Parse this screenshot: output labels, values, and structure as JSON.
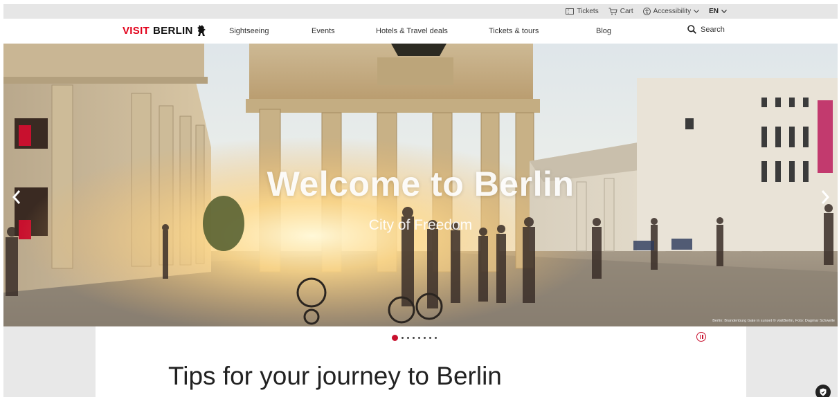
{
  "utility": {
    "tickets": "Tickets",
    "cart": "Cart",
    "accessibility": "Accessibility",
    "language": "EN"
  },
  "nav": {
    "logo_visit": "VISIT",
    "logo_berlin": "BERLIN",
    "items": [
      "Sightseeing",
      "Events",
      "Hotels & Travel deals",
      "Tickets & tours",
      "Blog"
    ],
    "search": "Search"
  },
  "hero": {
    "title": "Welcome to Berlin",
    "subtitle": "City of Freedom",
    "caption": "Berlin: Brandenburg Gate in sunset © visitBerlin, Foto: Dagmar Schwelle",
    "slide_count": 8,
    "active_slide": 1
  },
  "content": {
    "section_title": "Tips for your journey to Berlin"
  },
  "colors": {
    "brand_red": "#e2001a",
    "accent_red": "#c8102e"
  },
  "icons": [
    "ticket-icon",
    "cart-icon",
    "accessibility-icon",
    "chevron-down-icon",
    "bear-icon",
    "search-icon",
    "chevron-left-icon",
    "chevron-right-icon",
    "pause-icon",
    "shield-icon"
  ]
}
